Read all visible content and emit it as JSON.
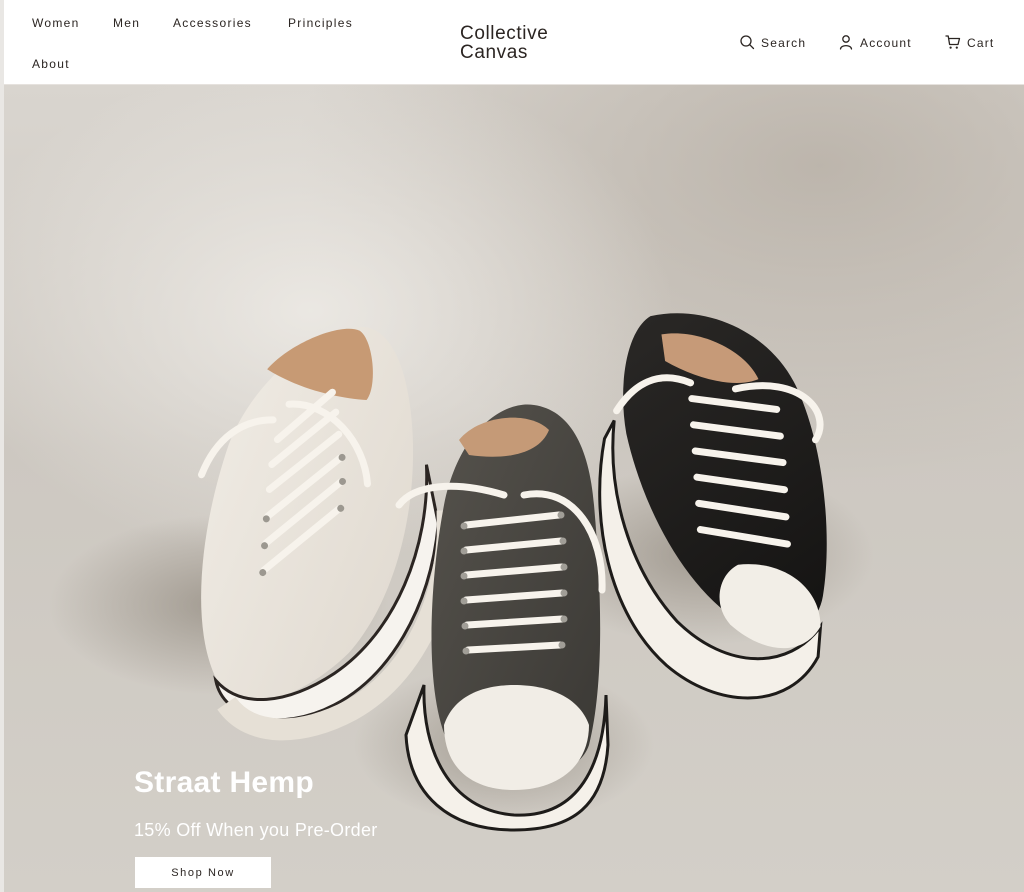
{
  "nav": {
    "items": [
      {
        "label": "Women"
      },
      {
        "label": "Men"
      },
      {
        "label": "Accessories"
      },
      {
        "label": "Principles"
      },
      {
        "label": "About"
      }
    ]
  },
  "brand": {
    "line1": "Collective",
    "line2": "Canvas"
  },
  "utilities": {
    "search": {
      "label": "Search",
      "icon": "search-icon"
    },
    "account": {
      "label": "Account",
      "icon": "user-icon"
    },
    "cart": {
      "label": "Cart",
      "icon": "cart-icon"
    }
  },
  "hero": {
    "title": "Straat Hemp",
    "subtitle": "15% Off When you Pre-Order",
    "cta": "Shop Now"
  },
  "colors": {
    "text": "#2b2522",
    "background": "#ffffff",
    "hero_bg": "#d3cfc8"
  }
}
